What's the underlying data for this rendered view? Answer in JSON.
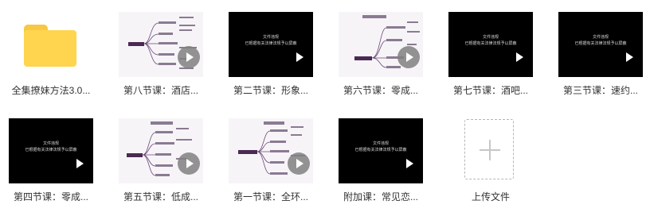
{
  "files": [
    {
      "name": "全集撩妹方法3.0...",
      "kind": "folder"
    },
    {
      "name": "第八节课：酒店...",
      "kind": "video-mindmap"
    },
    {
      "name": "第二节课：形象...",
      "kind": "video-black"
    },
    {
      "name": "第六节课：零成...",
      "kind": "video-mindmap"
    },
    {
      "name": "第七节课：酒吧...",
      "kind": "video-black"
    },
    {
      "name": "第三节课：速约...",
      "kind": "video-black"
    },
    {
      "name": "第四节课：零成...",
      "kind": "video-black"
    },
    {
      "name": "第五节课：低成...",
      "kind": "video-mindmap"
    },
    {
      "name": "第一节课：全环...",
      "kind": "video-mindmap"
    },
    {
      "name": "附加课：常见恋...",
      "kind": "video-black"
    }
  ],
  "upload": {
    "label": "上传文件"
  },
  "thumbnail_watermark": {
    "line1": "文件违规",
    "line2": "已根据有关法律法规予以屏蔽"
  },
  "colors": {
    "folder": "#ffd54f",
    "mindmap_accent": "#4a2a52",
    "text": "#333333"
  }
}
